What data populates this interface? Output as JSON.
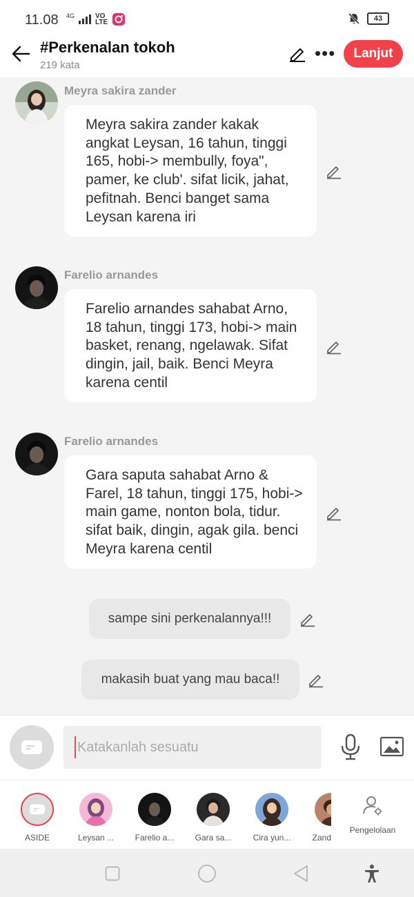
{
  "status_bar": {
    "time": "11.08",
    "network": "4G",
    "volte": "VO LTE",
    "battery": "43"
  },
  "header": {
    "title": "#Perkenalan tokoh",
    "word_count": "219 kata",
    "next_label": "Lanjut"
  },
  "messages": [
    {
      "sender": "Meyra sakira zander",
      "text": "Meyra sakira zander kakak angkat Leysan, 16 tahun, tinggi 165, hobi-> membully, foya\", pamer, ke club'. sifat licik, jahat, pefitnah. Benci banget sama Leysan karena iri"
    },
    {
      "sender": "Farelio arnandes",
      "text": "Farelio arnandes sahabat Arno, 18 tahun, tinggi 173, hobi-> main basket, renang, ngelawak. Sifat dingin, jail, baik. Benci Meyra karena centil"
    },
    {
      "sender": "Farelio arnandes",
      "text": "Gara saputa sahabat Arno & Farel, 18 tahun, tinggi 175, hobi-> main game, nonton bola, tidur. sifat baik, dingin, agak gila. benci Meyra karena centil"
    }
  ],
  "asides": [
    {
      "text": "sampe sini perkenalannya!!!"
    },
    {
      "text": "makasih buat yang mau baca!!"
    }
  ],
  "composer": {
    "placeholder": "Katakanlah sesuatu"
  },
  "characters": [
    {
      "label": "ASIDE"
    },
    {
      "label": "Leysan ..."
    },
    {
      "label": "Farelio a..."
    },
    {
      "label": "Gara sa..."
    },
    {
      "label": "Cira yun..."
    },
    {
      "label": "Zand"
    },
    {
      "label": "Pengelolaan"
    }
  ],
  "colors": {
    "accent": "#f2414b",
    "caret": "#e2495a"
  }
}
